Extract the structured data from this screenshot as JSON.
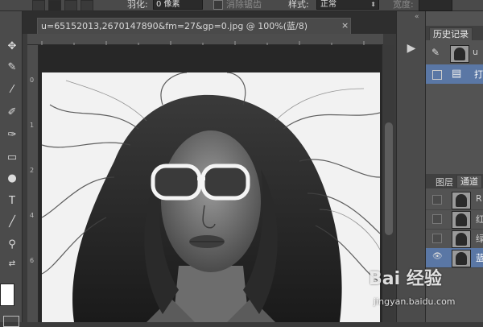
{
  "options_bar": {
    "feather_label": "羽化:",
    "feather_value": "0 像素",
    "antialias_label": "消除锯齿",
    "style_label": "样式:",
    "style_value": "正常",
    "width_label": "宽度:"
  },
  "document": {
    "tab_title": "u=65152013,2670147890&fm=27&gp=0.jpg @ 100%(蓝/8)",
    "close_glyph": "×"
  },
  "ruler": {
    "left_marks": [
      "0",
      "1",
      "2",
      "4",
      "6"
    ]
  },
  "history_panel": {
    "tab_label": "历史记录",
    "rows": [
      {
        "label": "u"
      },
      {
        "label": "打"
      }
    ]
  },
  "channels_panel": {
    "layers_tab_label": "图层",
    "channels_tab_label": "通道",
    "rows": [
      {
        "label": "R",
        "visible": false
      },
      {
        "label": "红",
        "visible": false
      },
      {
        "label": "绿",
        "visible": false
      },
      {
        "label": "蓝",
        "visible": true,
        "selected": true
      }
    ]
  },
  "watermark": {
    "logo_text": "Bai 经验",
    "url_text": "jingyan.baidu.com"
  },
  "icons": {
    "collapse_arrows": "«",
    "play": "▶"
  }
}
